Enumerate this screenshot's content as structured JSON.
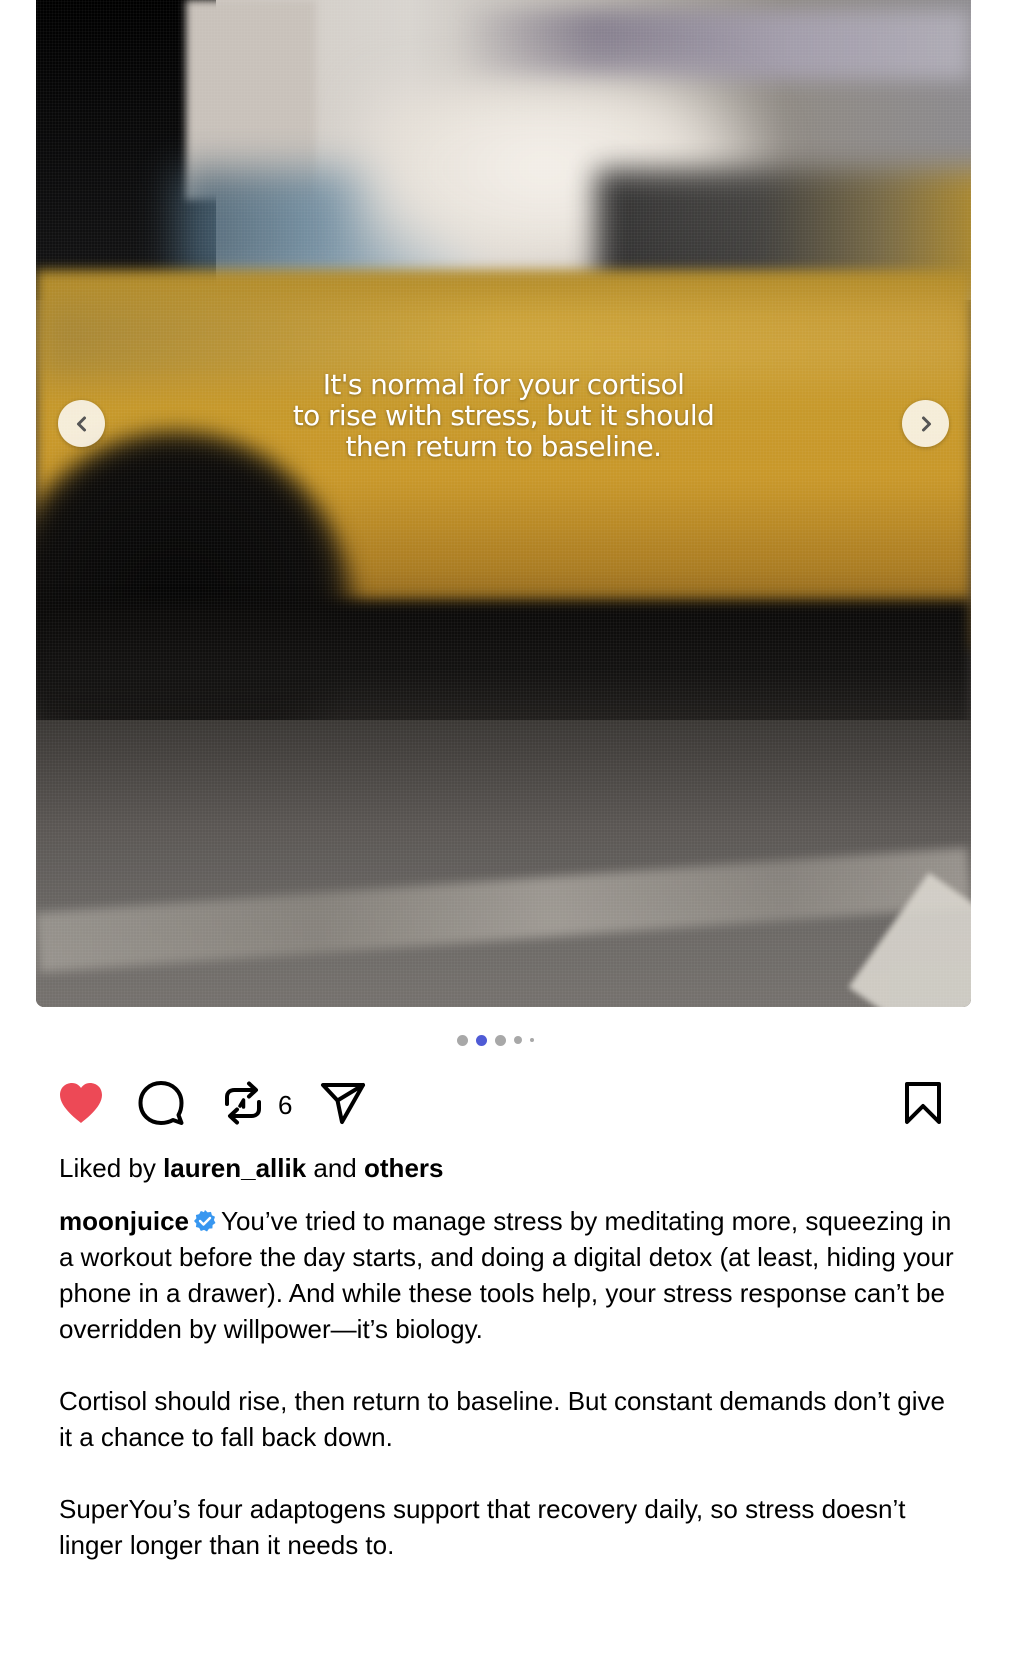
{
  "post": {
    "media": {
      "overlay_lines": [
        "It's normal for your cortisol",
        "to rise with stress, but it should",
        "then return to baseline."
      ],
      "prev_icon": "chevron-left-icon",
      "next_icon": "chevron-right-icon"
    },
    "carousel": {
      "active_index": 2,
      "total_visible_dots": 5
    },
    "actions": {
      "like_icon": "heart-filled-icon",
      "comment_icon": "comment-icon",
      "repost_icon": "repost-icon",
      "repost_count": "6",
      "share_icon": "send-icon",
      "save_icon": "bookmark-icon",
      "like_color": "#ed4956"
    },
    "likes": {
      "prefix": "Liked by",
      "user": "lauren_allik",
      "conjunction": "and",
      "others": "others"
    },
    "caption": {
      "username": "moonjuice",
      "verified_color": "#3897f0",
      "paragraph_1": "You’ve tried to manage stress by meditating more, squeezing in a workout before the day starts, and doing a digital detox (at least, hiding your phone in a drawer). And while these tools help, your stress response can’t be overridden by willpower—it’s biology.",
      "paragraph_2": "Cortisol should rise, then return to baseline. But constant demands don’t give it a chance to fall back down.",
      "paragraph_3": "SuperYou’s four adaptogens support that recovery daily, so stress doesn’t linger longer than it needs to."
    }
  }
}
